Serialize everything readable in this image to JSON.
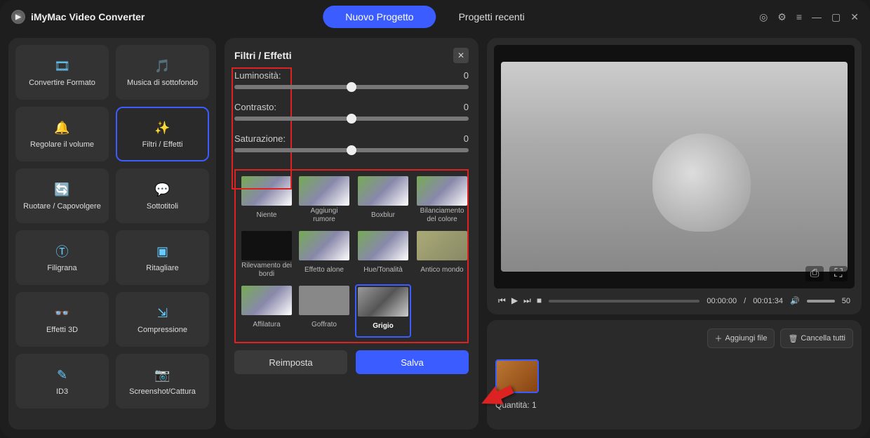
{
  "app_title": "iMyMac Video Converter",
  "tabs": {
    "new": "Nuovo Progetto",
    "recent": "Progetti recenti"
  },
  "sidebar": [
    {
      "label": "Convertire Formato",
      "icon": "🎞"
    },
    {
      "label": "Musica di sottofondo",
      "icon": "🎵"
    },
    {
      "label": "Regolare il volume",
      "icon": "🔔"
    },
    {
      "label": "Filtri / Effetti",
      "icon": "✨",
      "active": true
    },
    {
      "label": "Ruotare / Capovolgere",
      "icon": "🔄"
    },
    {
      "label": "Sottotitoli",
      "icon": "💬"
    },
    {
      "label": "Filigrana",
      "icon": "Ⓣ"
    },
    {
      "label": "Ritagliare",
      "icon": "▣"
    },
    {
      "label": "Effetti 3D",
      "icon": "👓"
    },
    {
      "label": "Compressione",
      "icon": "⇲"
    },
    {
      "label": "ID3",
      "icon": "✎"
    },
    {
      "label": "Screenshot/Cattura",
      "icon": "📷"
    }
  ],
  "center": {
    "title": "Filtri / Effetti",
    "sliders": [
      {
        "name": "Luminosità:",
        "value": "0"
      },
      {
        "name": "Contrasto:",
        "value": "0"
      },
      {
        "name": "Saturazione:",
        "value": "0"
      }
    ],
    "filters": [
      "Niente",
      "Aggiungi rumore",
      "Boxblur",
      "Bilanciamento del colore",
      "Rilevamento dei bordi",
      "Effetto alone",
      "Hue/Tonalità",
      "Antico mondo",
      "Affilatura",
      "Goffrato",
      "Grigio"
    ],
    "selected_filter": 10,
    "reset": "Reimposta",
    "save": "Salva"
  },
  "preview": {
    "time_current": "00:00:00",
    "time_total": "00:01:34",
    "volume": "50"
  },
  "queue": {
    "add_file": "Aggiungi file",
    "clear_all": "Cancella tutti",
    "count_label": "Quantità: 1"
  }
}
